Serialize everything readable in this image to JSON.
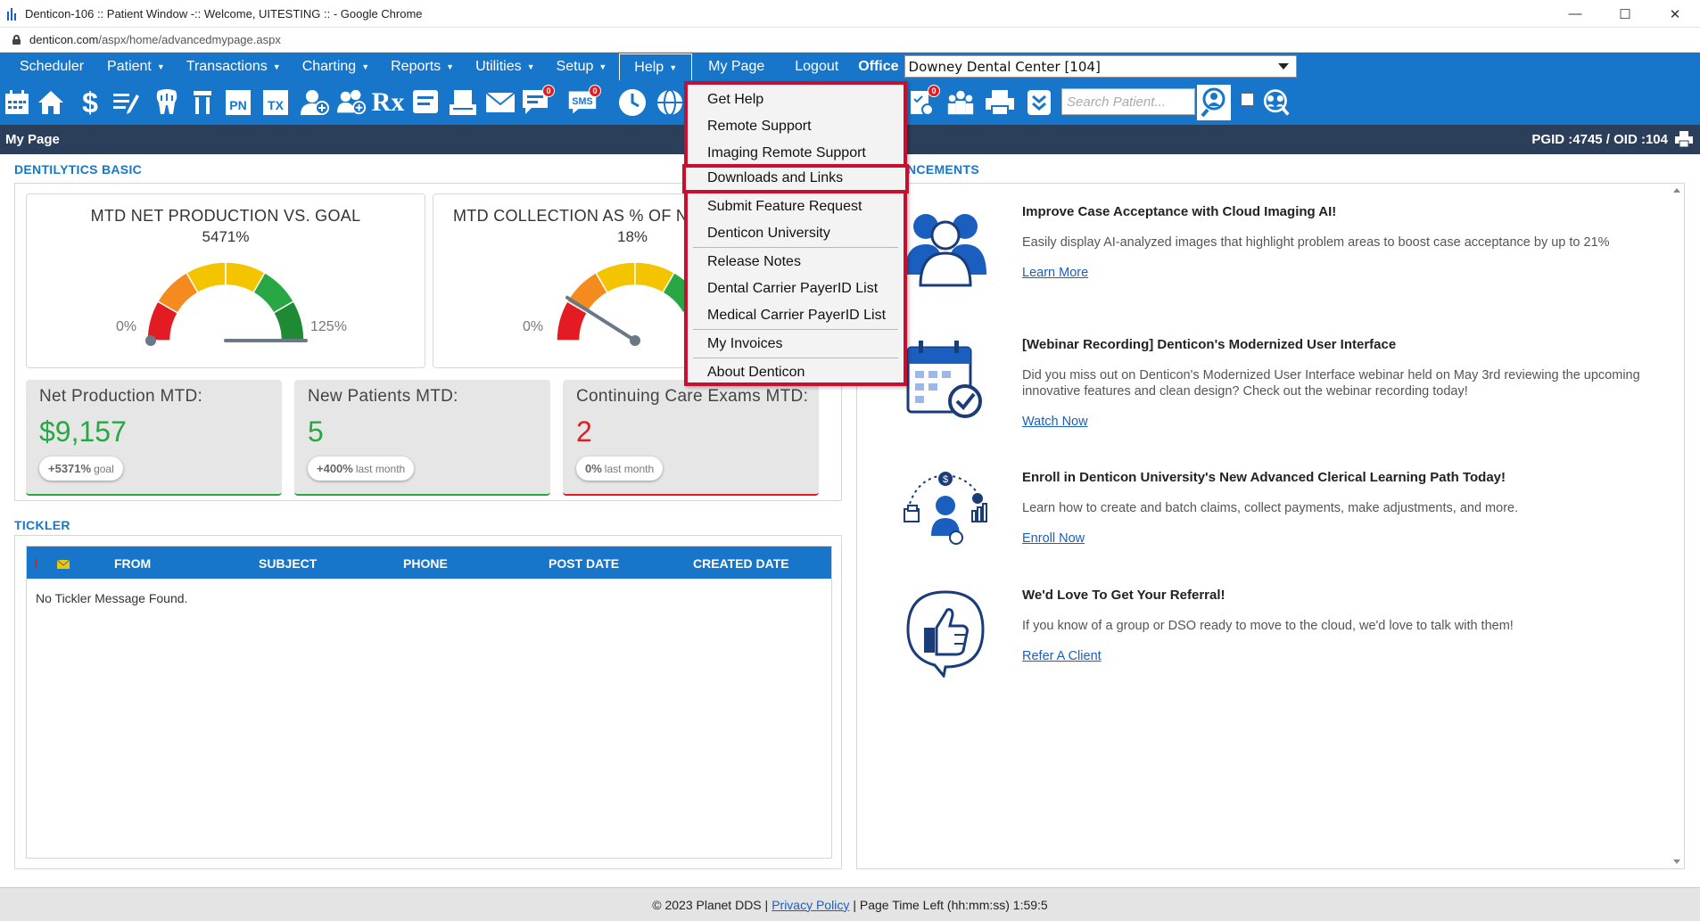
{
  "browser": {
    "title": "Denticon-106 :: Patient Window -:: Welcome, UITESTING :: - Google Chrome",
    "url_domain": "denticon.com",
    "url_path": "/aspx/home/advancedmypage.aspx"
  },
  "nav": {
    "items": [
      {
        "label": "Scheduler",
        "caret": false
      },
      {
        "label": "Patient",
        "caret": true
      },
      {
        "label": "Transactions",
        "caret": true
      },
      {
        "label": "Charting",
        "caret": true
      },
      {
        "label": "Reports",
        "caret": true
      },
      {
        "label": "Utilities",
        "caret": true
      },
      {
        "label": "Setup",
        "caret": true
      },
      {
        "label": "Help",
        "caret": true
      },
      {
        "label": "My Page",
        "caret": false
      },
      {
        "label": "Logout",
        "caret": false
      }
    ],
    "caret_glyph": "▼",
    "office_label": "Office",
    "office_value": "Downey Dental Center [104]"
  },
  "toolbar": {
    "search_placeholder": "Search Patient...",
    "letter_icons": {
      "pn": "PN",
      "tx": "TX",
      "rx": "Rx",
      "sms": "SMS"
    },
    "badges": {
      "messages": "0",
      "sms": "0",
      "tasks": "0"
    }
  },
  "page_bar": {
    "title": "My Page",
    "ids": "PGID :4745 / OID :104"
  },
  "dentilytics": {
    "section_title": "DENTILYTICS BASIC",
    "gauges": [
      {
        "title": "MTD NET PRODUCTION VS. GOAL",
        "value": "5471%",
        "min": "0%",
        "max": "125%",
        "needle_fraction": 1.0
      },
      {
        "title": "MTD COLLECTION AS % OF NE",
        "value": "18%",
        "min": "0%",
        "max": "",
        "needle_fraction": 0.18
      }
    ],
    "stats": [
      {
        "label": "Net Production MTD:",
        "value": "$9,157",
        "pill_bold": "+5371%",
        "pill_text": "goal"
      },
      {
        "label": "New Patients MTD:",
        "value": "5",
        "pill_bold": "+400%",
        "pill_text": "last month"
      },
      {
        "label": "Continuing Care Exams MTD:",
        "value": "2",
        "pill_bold": "0%",
        "pill_text": "last month"
      }
    ]
  },
  "tickler": {
    "section_title": "TICKLER",
    "flag": "!",
    "columns": [
      "FROM",
      "SUBJECT",
      "PHONE",
      "POST DATE",
      "CREATED DATE"
    ],
    "empty_message": "No Tickler Message Found."
  },
  "announcements": {
    "section_title_visible": "NCEMENTS",
    "items": [
      {
        "title": "Improve Case Acceptance with Cloud Imaging AI!",
        "body": "Easily display AI-analyzed images that highlight problem areas to boost case acceptance by up to 21%",
        "link": "Learn More",
        "icon": "people-icon"
      },
      {
        "title": "[Webinar Recording] Denticon's Modernized User Interface",
        "body": "Did you miss out on Denticon's Modernized User Interface webinar held on May 3rd reviewing the upcoming innovative features and clean design? Check out the webinar recording today!",
        "link": "Watch Now",
        "icon": "calendar-check-icon"
      },
      {
        "title": "Enroll in Denticon University's New Advanced Clerical Learning Path Today!",
        "body": "Learn how to create and batch claims, collect payments, make adjustments, and more.",
        "link": "Enroll Now",
        "icon": "learning-path-icon"
      },
      {
        "title": "We'd Love To Get Your Referral!",
        "body": "If you know of a group or DSO ready to move to the cloud, we'd love to talk with them!",
        "link": "Refer A Client",
        "icon": "thumbs-up-icon"
      }
    ]
  },
  "help_menu": {
    "items": [
      "Get Help",
      "Remote Support",
      "Imaging Remote Support",
      "Downloads and Links",
      "Submit Feature Request",
      "Denticon University",
      "Release Notes",
      "Dental Carrier PayerID List",
      "Medical Carrier PayerID List",
      "My Invoices",
      "About Denticon"
    ],
    "highlighted": "Downloads and Links"
  },
  "footer": {
    "copyright": "© 2023 Planet DDS |",
    "privacy": "Privacy Policy",
    "time_left": "| Page Time Left (hh:mm:ss) 1:59:5"
  },
  "colors": {
    "brand_blue": "#1776c9",
    "header_dark": "#2b3f5a",
    "highlight_red": "#c8102e",
    "positive_green": "#28a745",
    "negative_red": "#e31b23"
  }
}
